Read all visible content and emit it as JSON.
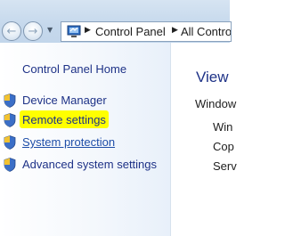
{
  "address_bar": {
    "breadcrumbs": [
      "Control Panel",
      "All Control"
    ]
  },
  "sidebar": {
    "home_label": "Control Panel Home",
    "items": [
      {
        "label": "Device Manager",
        "icon": "uac-shield-icon"
      },
      {
        "label": "Remote settings",
        "icon": "uac-shield-icon",
        "highlighted": true,
        "highlight_color": "#ffff00"
      },
      {
        "label": "System protection",
        "icon": "uac-shield-icon"
      },
      {
        "label": "Advanced system settings",
        "icon": "uac-shield-icon"
      }
    ]
  },
  "main": {
    "title": "View",
    "section": "Window",
    "lines": [
      "Win",
      "Cop",
      "Serv"
    ]
  },
  "colors": {
    "link": "#1e3287",
    "hover_link": "#1f4ea8",
    "highlight": "#ffff00",
    "titlebar": "#c5d8ec"
  }
}
